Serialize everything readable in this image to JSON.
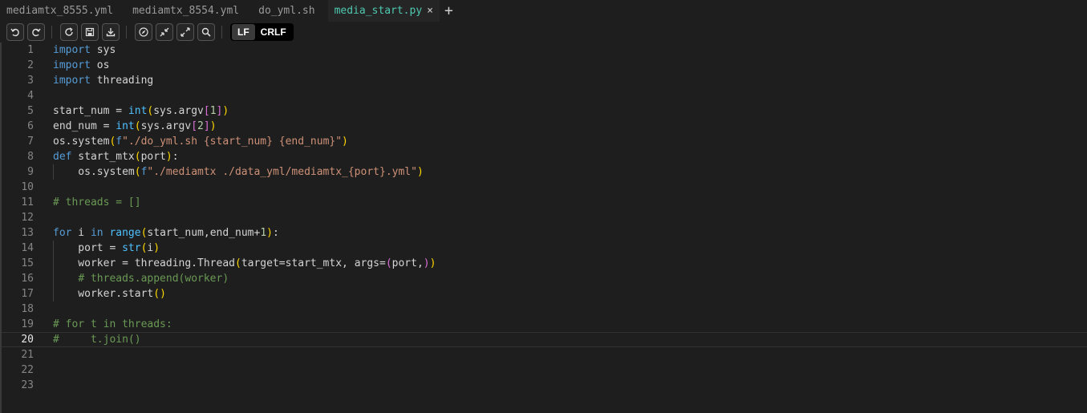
{
  "tabs": [
    {
      "label": "mediamtx_8555.yml",
      "active": false
    },
    {
      "label": "mediamtx_8554.yml",
      "active": false
    },
    {
      "label": "do_yml.sh",
      "active": false
    },
    {
      "label": "media_start.py",
      "active": true
    }
  ],
  "new_tab_icon": "+",
  "close_icon": "×",
  "toolbar": {
    "buttons": [
      "undo-icon",
      "redo-icon",
      "reload-icon",
      "save-icon",
      "download-icon",
      "compass-icon",
      "collapse-icon",
      "expand-icon",
      "search-icon"
    ],
    "eol_options": [
      "LF",
      "CRLF"
    ],
    "eol_selected": "LF"
  },
  "editor": {
    "current_line": 20,
    "lines": [
      "import sys",
      "import os",
      "import threading",
      "",
      "start_num = int(sys.argv[1])",
      "end_num = int(sys.argv[2])",
      "os.system(f\"./do_yml.sh {start_num} {end_num}\")",
      "def start_mtx(port):",
      "    os.system(f\"./mediamtx ./data_yml/mediamtx_{port}.yml\")",
      "",
      "# threads = []",
      "",
      "for i in range(start_num,end_num+1):",
      "    port = str(i)",
      "    worker = threading.Thread(target=start_mtx, args=(port,))",
      "    # threads.append(worker)",
      "    worker.start()",
      "",
      "# for t in threads:",
      "#     t.join()",
      "",
      "",
      ""
    ]
  },
  "colors": {
    "background": "#1e1e1e",
    "keyword": "#569cd6",
    "string": "#ce9178",
    "comment": "#6a9955",
    "active_tab": "#4ec9b0"
  }
}
